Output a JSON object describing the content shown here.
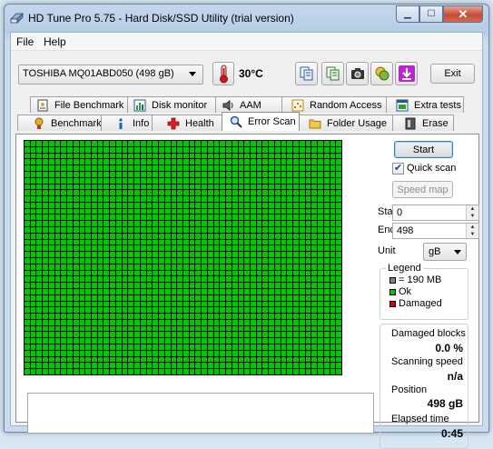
{
  "window": {
    "title": "HD Tune Pro 5.75 - Hard Disk/SSD Utility (trial version)"
  },
  "menu": {
    "file": "File",
    "help": "Help"
  },
  "toolbar": {
    "drive": "TOSHIBA MQ01ABD050 (498 gB)",
    "temperature": "30°C",
    "exit": "Exit"
  },
  "tabs_back": [
    "File Benchmark",
    "Disk monitor",
    "AAM",
    "Random Access",
    "Extra tests"
  ],
  "tabs_front": [
    "Benchmark",
    "Info",
    "Health",
    "Error Scan",
    "Folder Usage",
    "Erase"
  ],
  "active_tab": "Error Scan",
  "scan": {
    "start_button": "Start",
    "quick_scan_label": "Quick scan",
    "quick_scan_checked": true,
    "speed_map_button": "Speed map",
    "start_label": "Start",
    "start_value": "0",
    "end_label": "End",
    "end_value": "498",
    "unit_label": "Unit",
    "unit_value": "gB"
  },
  "legend": {
    "title": "Legend",
    "block": "= 190 MB",
    "ok": "Ok",
    "damaged": "Damaged"
  },
  "stats": {
    "damaged_label": "Damaged blocks",
    "damaged_value": "0.0 %",
    "speed_label": "Scanning speed",
    "speed_value": "n/a",
    "position_label": "Position",
    "position_value": "498 gB",
    "elapsed_label": "Elapsed time",
    "elapsed_value": "0:45"
  },
  "colors": {
    "ok": "#00c800",
    "damaged": "#e00000",
    "block": "#808080",
    "grid_lines": "#000000"
  }
}
